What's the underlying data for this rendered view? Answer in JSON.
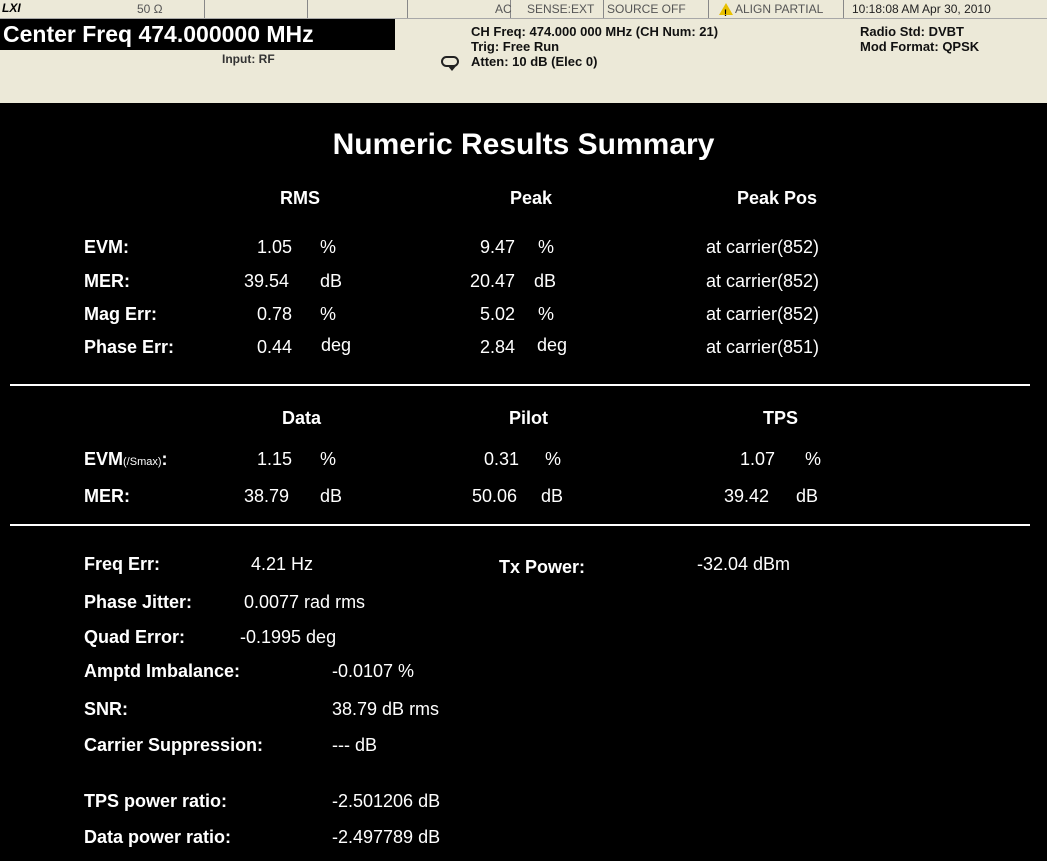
{
  "status": {
    "logo": "LXI",
    "impedance": "50 Ω",
    "coupling": "AC",
    "sense": "SENSE:EXT",
    "source": "SOURCE OFF",
    "align": "ALIGN PARTIAL",
    "datetime": "10:18:08 AM Apr 30, 2010",
    "warning_color": "#e8c000"
  },
  "header": {
    "center_freq": "Center Freq  474.000000 MHz",
    "input": "Input: RF",
    "ch_freq": "CH Freq: 474.000 000 MHz (CH Num: 21)",
    "trig": "Trig: Free Run",
    "atten": "Atten: 10 dB (Elec 0)",
    "radio_std": "Radio Std: DVBT",
    "mod_format": "Mod Format: QPSK",
    "loop_icon": "continuous-sweep-icon"
  },
  "main": {
    "title": "Numeric Results Summary",
    "section1": {
      "headers": [
        "RMS",
        "Peak",
        "Peak Pos"
      ],
      "rows": [
        {
          "label": "EVM:",
          "rms": "1.05",
          "rms_unit": "%",
          "peak": "9.47",
          "peak_unit": "%",
          "pos": "at carrier(852)"
        },
        {
          "label": "MER:",
          "rms": "39.54",
          "rms_unit": "dB",
          "peak": "20.47",
          "peak_unit": "dB",
          "pos": "at carrier(852)"
        },
        {
          "label": "Mag Err:",
          "rms": "0.78",
          "rms_unit": "%",
          "peak": "5.02",
          "peak_unit": "%",
          "pos": "at carrier(852)"
        },
        {
          "label": "Phase Err:",
          "rms": "0.44",
          "rms_unit": "deg",
          "peak": "2.84",
          "peak_unit": "deg",
          "pos": "at carrier(851)"
        }
      ]
    },
    "section2": {
      "headers": [
        "Data",
        "Pilot",
        "TPS"
      ],
      "evm_label": "EVM",
      "evm_sub": "(/Smax)",
      "evm_colon": ":",
      "evm": {
        "data": "1.15",
        "data_unit": "%",
        "pilot": "0.31",
        "pilot_unit": "%",
        "tps": "1.07",
        "tps_unit": "%"
      },
      "mer_label": "MER:",
      "mer": {
        "data": "38.79",
        "data_unit": "dB",
        "pilot": "50.06",
        "pilot_unit": "dB",
        "tps": "39.42",
        "tps_unit": "dB"
      }
    },
    "section3": {
      "freq_err_label": "Freq Err:",
      "freq_err": "4.21 Hz",
      "tx_power_label": "Tx Power:",
      "tx_power": "-32.04 dBm",
      "phase_jitter_label": "Phase Jitter:",
      "phase_jitter": "0.0077 rad rms",
      "quad_error_label": "Quad Error:",
      "quad_error": "-0.1995 deg",
      "amptd_label": "Amptd Imbalance:",
      "amptd": "-0.0107 %",
      "snr_label": "SNR:",
      "snr": "38.79 dB rms",
      "carrier_label": "Carrier Suppression:",
      "carrier": "--- dB",
      "tps_ratio_label": "TPS power ratio:",
      "tps_ratio": "-2.501206 dB",
      "data_ratio_label": "Data power ratio:",
      "data_ratio": "-2.497789 dB"
    }
  }
}
